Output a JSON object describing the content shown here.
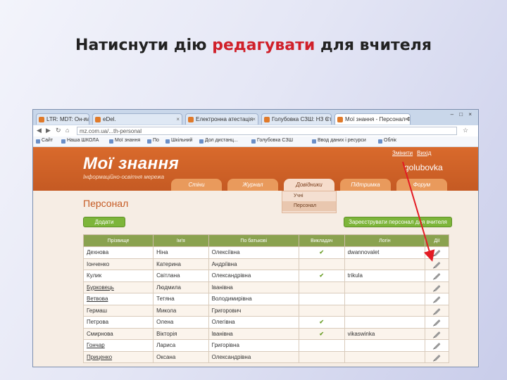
{
  "slide": {
    "title_pre": "Натиснути дію ",
    "title_highlight": "редагувати",
    "title_post": " для вчителя"
  },
  "browser": {
    "tabs": [
      {
        "label": "LTR: MDT: Он-лайн-режим Учебн"
      },
      {
        "label": "eDel."
      },
      {
        "label": "Електронна атестація"
      },
      {
        "label": "Голубовка СЗШ: НЗ Ступ"
      },
      {
        "label": "Мої знання - Персонал Фол"
      }
    ],
    "window_controls": "– □ ×",
    "url": "mz.com.ua/...th-personal",
    "bookmarks": [
      "Сайт",
      "Наша ШКОЛА",
      "Мої знання",
      "По",
      "Шкільний",
      "Дол дистанц...",
      "Голубовка СЗШ",
      "Ввод даних і ресурси",
      "Облік"
    ]
  },
  "site": {
    "logo": "Мої знання",
    "tagline": "Інформаційно-освітня мережа",
    "top_links": [
      "Змінити",
      "Вихід"
    ],
    "username": "golubovka",
    "menu": [
      "Стіни",
      "Журнал",
      "Довідники",
      "Підтримка",
      "Форум"
    ],
    "dropdown": [
      "Учні",
      "Персонал"
    ],
    "page_title": "Персонал",
    "add_button": "Додати",
    "send_button": "Зареєструвати персонал для вчителя"
  },
  "table": {
    "headers": [
      "Прізвище",
      "Ім'я",
      "По батькові",
      "Викладач",
      "Логін",
      "Дії"
    ],
    "rows": [
      {
        "surname": "Дехнова",
        "name": "Ніна",
        "patronymic": "Олексіївна",
        "teacher": true,
        "login": "dwannovalet"
      },
      {
        "surname": "Іонченко",
        "name": "Катерина",
        "patronymic": "Андріївна",
        "teacher": false,
        "login": ""
      },
      {
        "surname": "Кулик",
        "name": "Світлана",
        "patronymic": "Олександрівна",
        "teacher": true,
        "login": "trikula"
      },
      {
        "surname": "Бурковець",
        "name": "Людмила",
        "patronymic": "Іванівна",
        "teacher": false,
        "login": ""
      },
      {
        "surname": "Ветвова",
        "name": "Тетяна",
        "patronymic": "Володимирівна",
        "teacher": false,
        "login": ""
      },
      {
        "surname": "Гермаш",
        "name": "Микола",
        "patronymic": "Григорович",
        "teacher": false,
        "login": ""
      },
      {
        "surname": "Петрова",
        "name": "Олена",
        "patronymic": "Олегівна",
        "teacher": true,
        "login": ""
      },
      {
        "surname": "Смирнова",
        "name": "Вікторія",
        "patronymic": "Іванівна",
        "teacher": true,
        "login": "vikaswinka"
      },
      {
        "surname": "Гончар",
        "name": "Лариса",
        "patronymic": "Григорівна",
        "teacher": false,
        "login": ""
      },
      {
        "surname": "Приценко",
        "name": "Оксана",
        "patronymic": "Олександрівна",
        "teacher": false,
        "login": ""
      }
    ]
  },
  "colors": {
    "arrow": "#e31b23",
    "brand": "#d96a2c",
    "table_header": "#8aa24f"
  }
}
